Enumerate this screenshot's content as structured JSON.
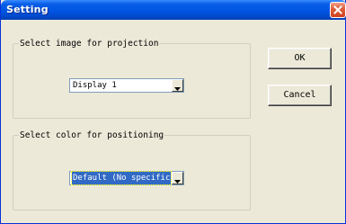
{
  "window": {
    "title": "Setting"
  },
  "projection_group": {
    "legend": "Select image for projection",
    "select_value": "Display 1"
  },
  "color_group": {
    "legend": "Select color for positioning",
    "select_value": "Default (No specific colo"
  },
  "buttons": {
    "ok_label": "OK",
    "cancel_label": "Cancel"
  },
  "icons": {
    "close": "close-icon",
    "dropdown": "chevron-down-icon"
  },
  "colors": {
    "titlebar": "#0054e3",
    "dialog_background": "#ece9d8",
    "close_button": "#e0603c",
    "selection_highlight": "#316ac5"
  }
}
